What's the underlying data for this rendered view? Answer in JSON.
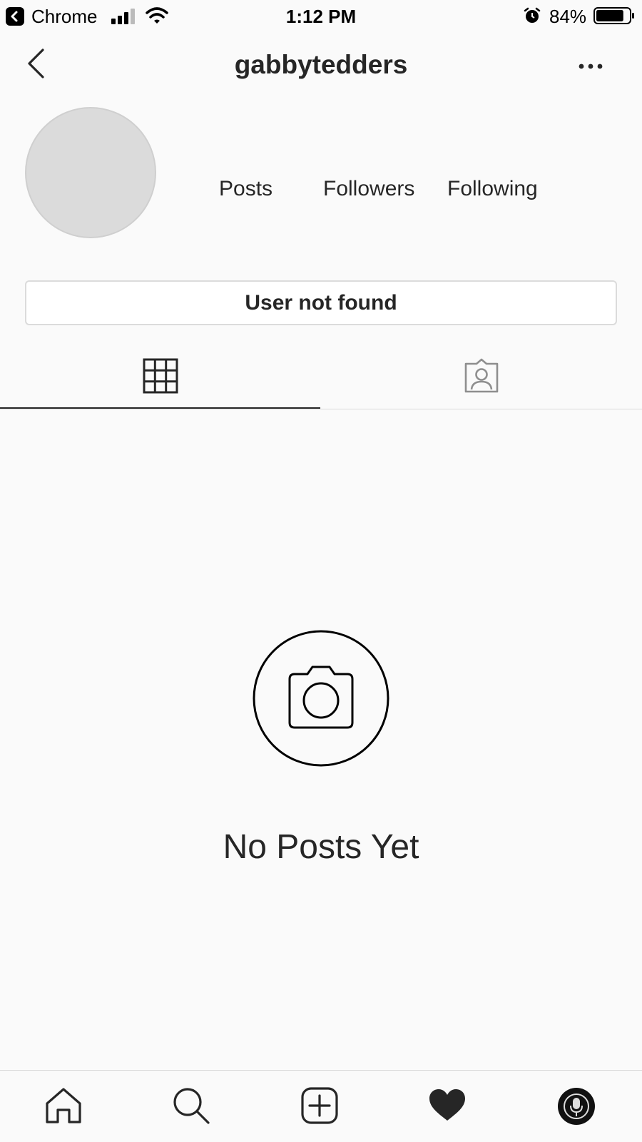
{
  "status_bar": {
    "back_app": "Chrome",
    "time": "1:12 PM",
    "battery_percent": "84%",
    "battery_level": 0.84
  },
  "header": {
    "username": "gabbytedders"
  },
  "profile": {
    "stats": {
      "posts_label": "Posts",
      "followers_label": "Followers",
      "following_label": "Following"
    },
    "status_button_label": "User not found"
  },
  "tabs": [
    {
      "name": "grid",
      "icon": "grid-icon",
      "active": true
    },
    {
      "name": "tagged",
      "icon": "tagged-user-icon",
      "active": false
    }
  ],
  "empty_state": {
    "icon": "camera-icon",
    "message": "No Posts Yet"
  },
  "tab_bar": {
    "items": [
      "home-icon",
      "search-icon",
      "new-post-icon",
      "activity-heart-icon",
      "profile-avatar"
    ]
  },
  "colors": {
    "background": "#fafafa",
    "text": "#262626",
    "border": "#dbdbdb"
  }
}
